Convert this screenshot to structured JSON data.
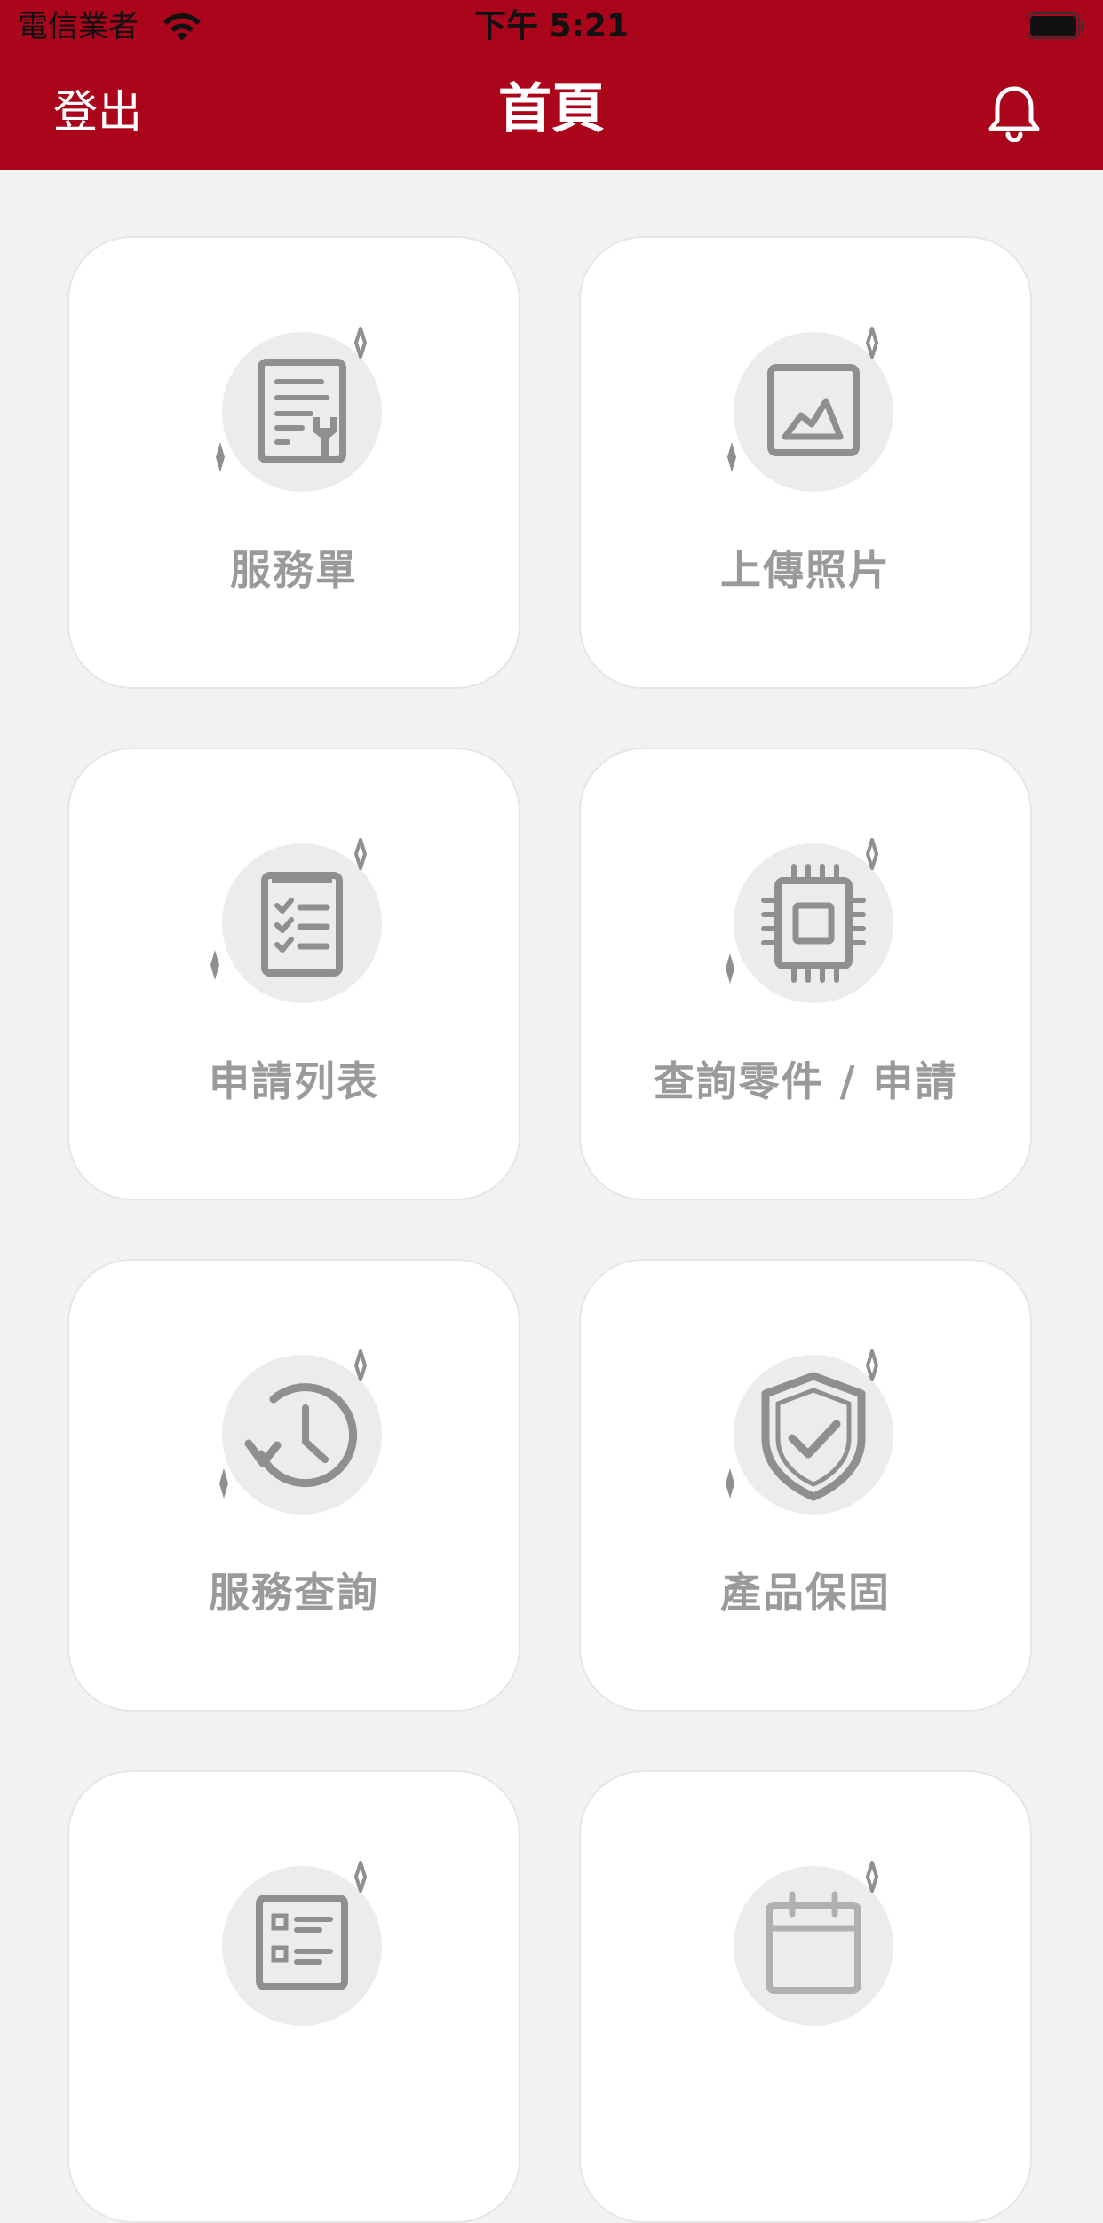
{
  "status_bar": {
    "carrier": "電信業者",
    "time": "下午 5:21"
  },
  "nav": {
    "logout_label": "登出",
    "title": "首頁"
  },
  "menu": {
    "items": [
      {
        "label": "服務單",
        "icon": "service-order-icon"
      },
      {
        "label": "上傳照片",
        "icon": "photo-upload-icon"
      },
      {
        "label": "申請列表",
        "icon": "checklist-icon"
      },
      {
        "label": "查詢零件 / 申請",
        "icon": "chip-icon"
      },
      {
        "label": "服務查詢",
        "icon": "history-clock-icon"
      },
      {
        "label": "產品保固",
        "icon": "shield-check-icon"
      },
      {
        "label": "",
        "icon": "list-document-icon"
      },
      {
        "label": "",
        "icon": "calendar-icon"
      }
    ]
  },
  "colors": {
    "brand": "#ab051c",
    "background": "#f2f2f2",
    "icon": "#8f8f8f",
    "label": "#9a9a9a"
  }
}
